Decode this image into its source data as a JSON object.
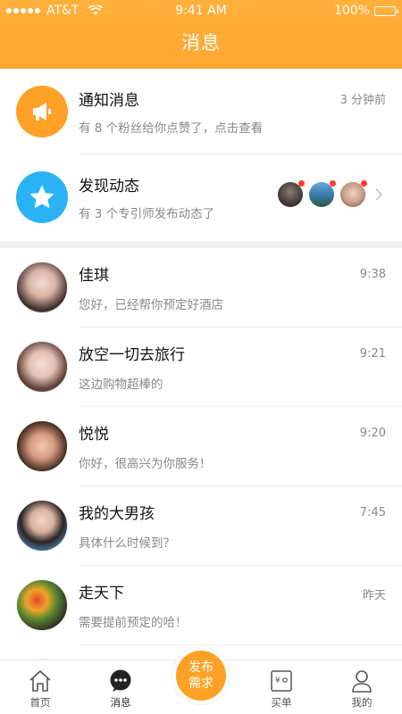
{
  "status_bar": {
    "carrier": "AT&T",
    "time": "9:41 AM",
    "battery": "100%"
  },
  "header": {
    "title": "消息"
  },
  "notifications": [
    {
      "title": "通知消息",
      "subtitle": "有 8 个粉丝给你点赞了，点击查看",
      "time": "3 分钟前",
      "icon": "megaphone-icon",
      "color": "#ffa126"
    },
    {
      "title": "发现动态",
      "subtitle": "有 3 个专引师发布动态了",
      "icon": "star-icon",
      "color": "#2ab3f4"
    }
  ],
  "chats": [
    {
      "name": "佳琪",
      "message": "您好，已经帮你预定好酒店",
      "time": "9:38"
    },
    {
      "name": "放空一切去旅行",
      "message": "这边购物超棒的",
      "time": "9:21"
    },
    {
      "name": "悦悦",
      "message": "你好，很高兴为你服务！",
      "time": "9:20"
    },
    {
      "name": "我的大男孩",
      "message": "具体什么时候到？",
      "time": "7:45"
    },
    {
      "name": "走天下",
      "message": "需要提前预定的哈！",
      "time": "昨天"
    }
  ],
  "tabbar": {
    "home": "首页",
    "messages": "消息",
    "publish_line1": "发布",
    "publish_line2": "需求",
    "orders": "买单",
    "mine": "我的"
  },
  "colors": {
    "accent": "#ffa126",
    "blue": "#2ab3f4",
    "badge": "#ff3b30"
  }
}
